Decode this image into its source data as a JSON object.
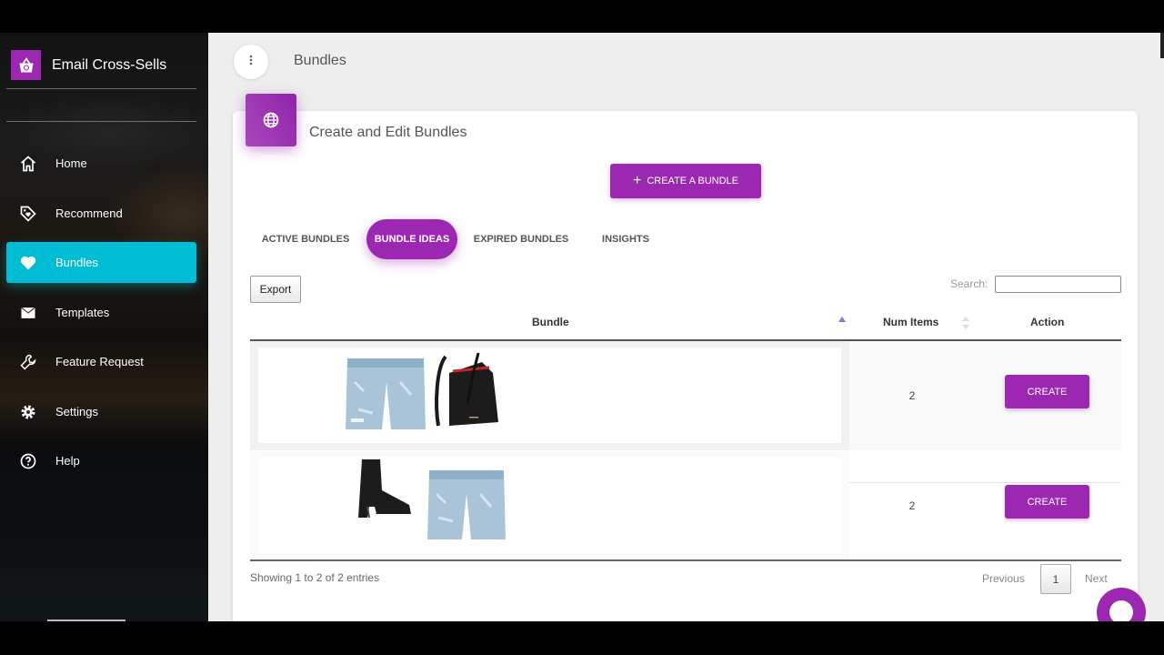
{
  "app": {
    "name": "Email Cross-Sells",
    "logo_icon": "shopping-basket-icon",
    "brand_color": "#9c27b0",
    "active_nav_color": "#00bcd4"
  },
  "sidebar": {
    "items": [
      {
        "label": "Home",
        "icon": "home-icon",
        "active": false
      },
      {
        "label": "Recommend",
        "icon": "tag-icon",
        "active": false
      },
      {
        "label": "Bundles",
        "icon": "heart-icon",
        "active": true
      },
      {
        "label": "Templates",
        "icon": "envelope-icon",
        "active": false
      },
      {
        "label": "Feature Request",
        "icon": "wrench-icon",
        "active": false
      },
      {
        "label": "Settings",
        "icon": "gear-icon",
        "active": false
      },
      {
        "label": "Help",
        "icon": "help-circle-icon",
        "active": false
      }
    ]
  },
  "header": {
    "menu_icon": "more-vertical-icon",
    "title": "Bundles"
  },
  "card": {
    "icon": "globe-icon",
    "title": "Create and Edit Bundles",
    "create_button": "CREATE A BUNDLE"
  },
  "tabs": [
    {
      "label": "ACTIVE BUNDLES",
      "active": false
    },
    {
      "label": "BUNDLE IDEAS",
      "active": true
    },
    {
      "label": "EXPIRED BUNDLES",
      "active": false
    },
    {
      "label": "INSIGHTS",
      "active": false
    }
  ],
  "table": {
    "export_label": "Export",
    "search_label": "Search:",
    "search_value": "",
    "columns": [
      "Bundle",
      "Num Items",
      "Action"
    ],
    "sort": {
      "column": "Bundle",
      "direction": "asc"
    },
    "rows": [
      {
        "products": [
          "distressed denim jeans",
          "black leather bucket bag"
        ],
        "num_items": "2",
        "action": "CREATE"
      },
      {
        "products": [
          "black leather ankle boot",
          "distressed denim jeans"
        ],
        "num_items": "2",
        "action": "CREATE"
      }
    ],
    "info": "Showing 1 to 2 of 2 entries",
    "pagination": {
      "previous": "Previous",
      "current": "1",
      "next": "Next"
    }
  },
  "chat": {
    "icon": "chat-bubble-icon"
  }
}
